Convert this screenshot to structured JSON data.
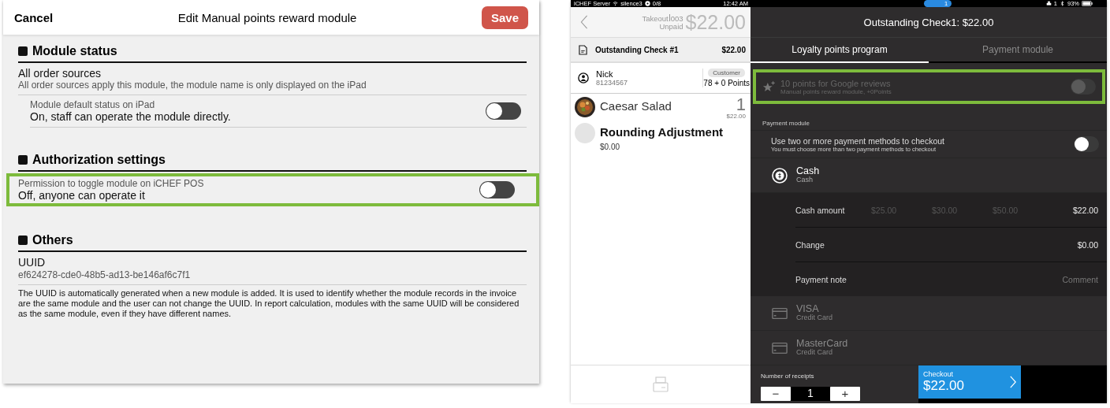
{
  "editor": {
    "cancel": "Cancel",
    "title": "Edit Manual points reward module",
    "save": "Save",
    "sections": [
      {
        "title": "Module status",
        "rows": [
          {
            "kind": "text",
            "title": "All order sources",
            "subtitle": "All order sources apply this module, the module name is only displayed on the iPad",
            "highlighted": false
          },
          {
            "kind": "toggle",
            "label": "Module default status on iPad",
            "value": "On, staff can operate the module directly.",
            "on": false,
            "indented": true,
            "highlighted": false
          }
        ]
      },
      {
        "title": "Authorization settings",
        "rows": [
          {
            "kind": "toggle",
            "label": "Permission to toggle module on iCHEF POS",
            "value": "Off, anyone can operate it",
            "on": false,
            "indented": false,
            "highlighted": true
          }
        ]
      },
      {
        "title": "Others",
        "rows": [
          {
            "kind": "uuid",
            "title": "UUID",
            "value": "ef624278-cde0-48b5-ad13-be146af6c7f1",
            "note": "The UUID is automatically generated when a new module is added. It is used to identify whether the module records in the invoice are the same module and the user can not change the UUID. In report calculation, modules with the same UUID will be considered as the same module, even if they have different names.",
            "highlighted": false
          }
        ]
      }
    ]
  },
  "pos": {
    "status_bar": {
      "server": "iCHEF Server",
      "network": "silence3",
      "devices": "0/8",
      "time": "12:42 AM",
      "pill": "1",
      "printers": "1",
      "battery": "93%"
    },
    "order": {
      "type": "Takeout",
      "number": "003",
      "payment_state": "Unpaid",
      "total": "$22.00"
    },
    "check": {
      "name": "Outstanding Check #1",
      "amount": "$22.00"
    },
    "customer": {
      "name": "Nick",
      "phone": "81234567",
      "badge": "Customer",
      "points": "78 + 0 Points"
    },
    "items": [
      {
        "kind": "picture",
        "name": "Caesar Salad",
        "qty": "1",
        "price": "$22.00"
      },
      {
        "kind": "blank",
        "name": "Rounding Adjustment",
        "price": "$0.00"
      }
    ],
    "panel": {
      "title": "Outstanding Check1: $22.00",
      "tabs": [
        {
          "label": "Loyalty points program",
          "selected": true
        },
        {
          "label": "Payment module",
          "selected": false
        }
      ],
      "reward": {
        "title": "10 points for Google reviews",
        "subtitle": "Manual points reward module, +0Points",
        "on": false,
        "disabled": true,
        "highlighted": true
      },
      "payment_label": "Payment module",
      "split": {
        "title": "Use two or more payment methods to checkout",
        "subtitle": "You must choose more than two payment methods to checkout",
        "on": false
      },
      "methods": [
        {
          "kind": "cash",
          "name": "Cash",
          "type": "Cash",
          "disabled": false,
          "expanded": true
        },
        {
          "kind": "card",
          "name": "VISA",
          "type": "Credit Card",
          "disabled": true,
          "expanded": false
        },
        {
          "kind": "card",
          "name": "MasterCard",
          "type": "Credit Card",
          "disabled": true,
          "expanded": false
        }
      ],
      "cash": {
        "amount_label": "Cash amount",
        "quick_amounts": [
          "$25.00",
          "$30.00",
          "$50.00"
        ],
        "amount": "$22.00",
        "change_label": "Change",
        "change": "$0.00",
        "note_label": "Payment note",
        "note_placeholder": "Comment"
      },
      "receipts": {
        "label": "Number of receipts",
        "minus": "−",
        "count": "1",
        "plus": "+"
      },
      "checkout": {
        "label": "Checkout",
        "amount": "$22.00"
      }
    }
  }
}
